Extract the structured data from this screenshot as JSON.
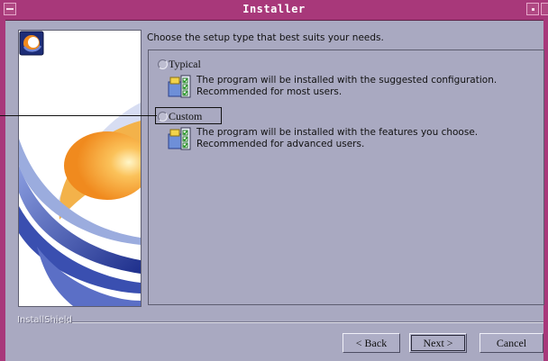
{
  "window": {
    "title": "Installer"
  },
  "prompt": "Choose the setup type that best suits your needs.",
  "options": [
    {
      "label": "Typical",
      "line1": "The program will be installed with the suggested configuration.",
      "line2": "Recommended for most users.",
      "selected": false
    },
    {
      "label": "Custom",
      "line1": "The program will be installed with the features you choose.",
      "line2": "Recommended for advanced users.",
      "selected": false,
      "focused": true
    }
  ],
  "brand": "InstallShield",
  "buttons": {
    "back": "< Back",
    "next": "Next >",
    "cancel": "Cancel"
  },
  "colors": {
    "titlebar": "#a8387a",
    "dialog": "#a9a9c1",
    "swoosh_orange": "#f08a1e",
    "swoosh_blue": "#2b3f9e"
  },
  "icons": [
    "window-menu-icon",
    "minimize-icon",
    "maximize-icon",
    "installshield-logo-icon",
    "setup-type-icon"
  ]
}
